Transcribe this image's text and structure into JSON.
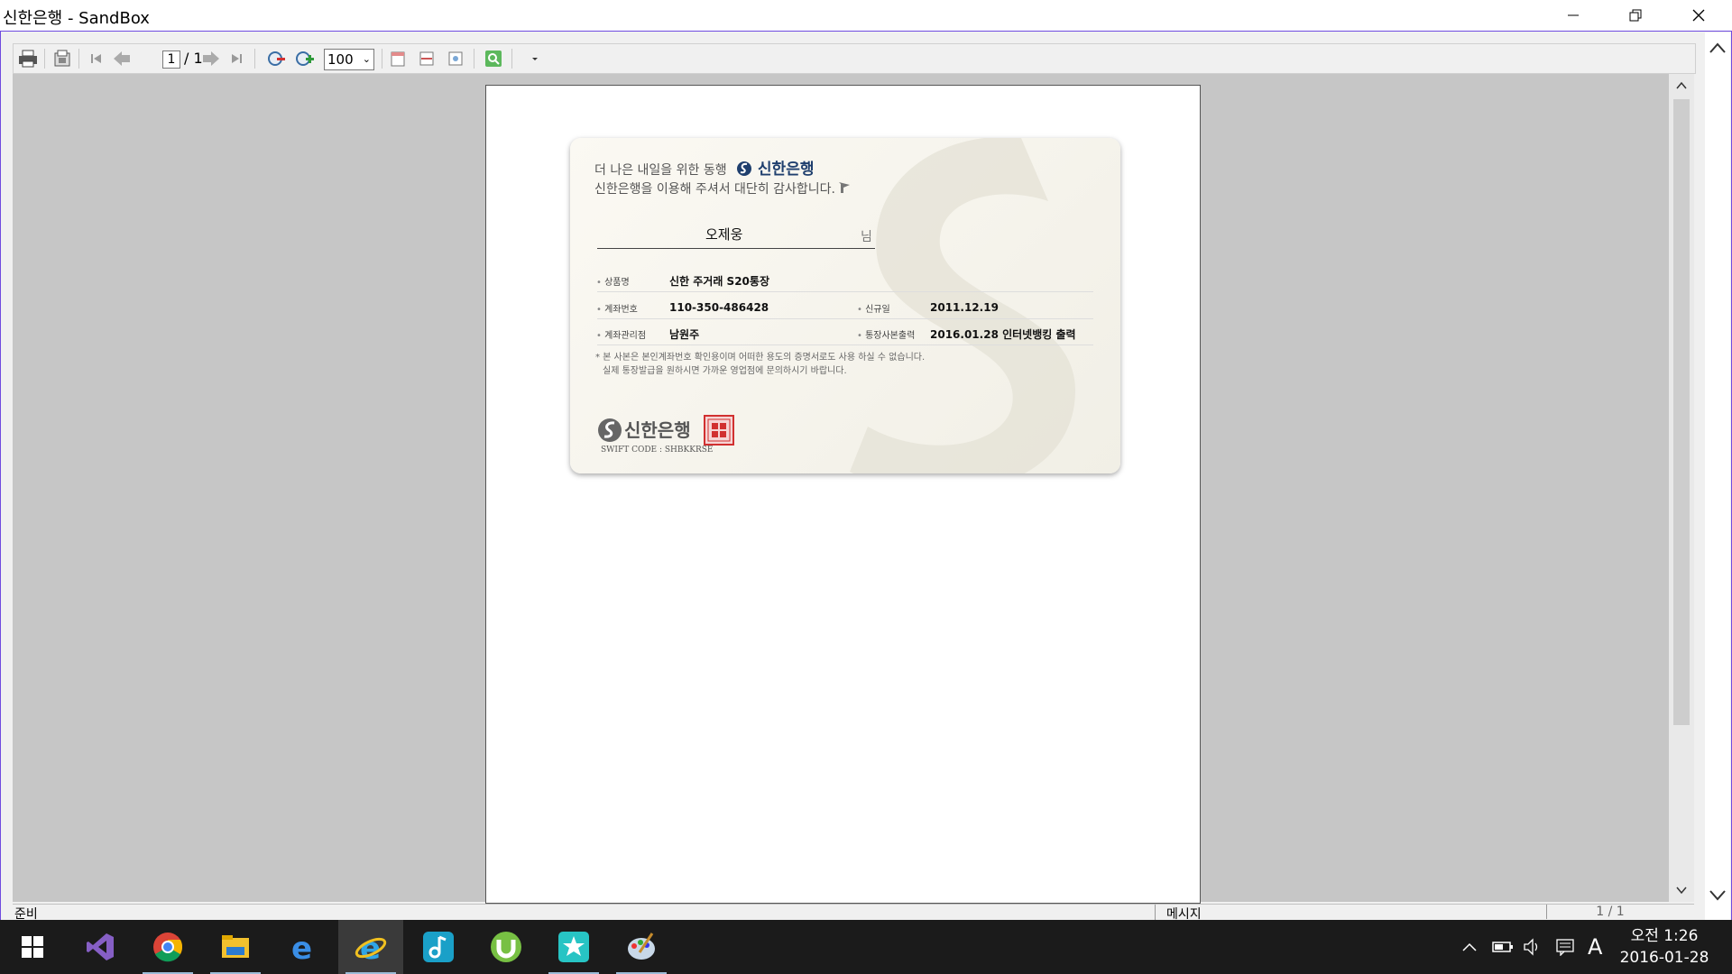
{
  "window": {
    "title": "신한은행 - SandBox"
  },
  "toolbar": {
    "page_current": "1",
    "page_total": "/ 1",
    "zoom": "100"
  },
  "card": {
    "line1": "더 나은 내일을 위한 동행",
    "brand": "신한은행",
    "line2": "신한은행을 이용해 주셔서 대단히 감사합니다.",
    "customer_name": "오제웅",
    "name_suffix": "님",
    "fields": {
      "product_label": "상품명",
      "product_value": "신한 주거래 S20통장",
      "account_label": "계좌번호",
      "account_value": "110-350-486428",
      "opened_label": "신규일",
      "opened_value": "2011.12.19",
      "branch_label": "계좌관리점",
      "branch_value": "남원주",
      "printed_label": "통장사본출력",
      "printed_value": "2016.01.28 인터넷뱅킹 출력"
    },
    "notice_1": "* 본 사본은 본인계좌번호 확인용이며 어떠한 용도의 증명서로도 사용 하실 수 없습니다.",
    "notice_2": "실제 통장발급을 원하시면 가까운 영업점에 문의하시기 바랍니다.",
    "brand_bottom": "신한은행",
    "swift": "SWIFT CODE : SHBKKRSE"
  },
  "status": {
    "ready": "준비",
    "message": "메시지",
    "page": "1 / 1"
  },
  "taskbar": {
    "apps": [
      "start-icon",
      "visual-studio-icon",
      "chrome-icon",
      "file-explorer-icon",
      "edge-icon",
      "internet-explorer-icon",
      "music-app-icon",
      "utorrent-icon",
      "star-app-icon",
      "paint-app-icon"
    ],
    "ime": "A",
    "time": "오전 1:26",
    "date": "2016-01-28"
  },
  "colors": {
    "frame": "#6f4be0",
    "brand": "#1f3f6e",
    "taskbar": "#1b1b1b"
  }
}
